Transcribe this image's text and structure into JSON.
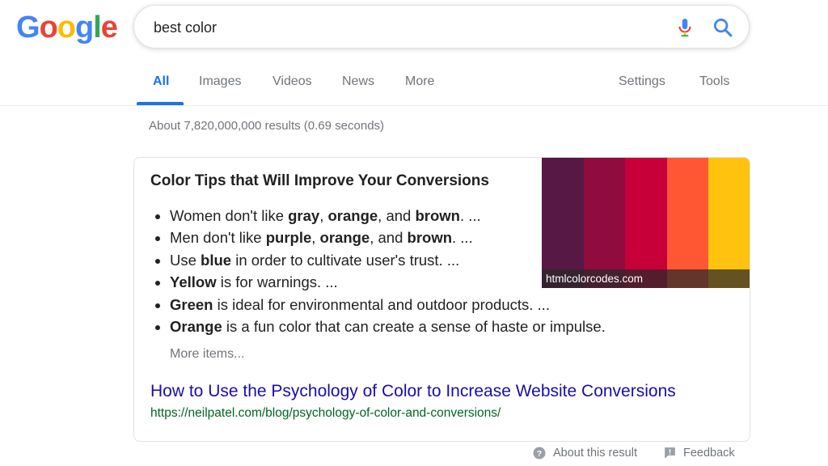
{
  "logo": {
    "text": "Google",
    "letters": [
      "G",
      "o",
      "o",
      "g",
      "l",
      "e"
    ]
  },
  "search": {
    "query": "best color",
    "placeholder": ""
  },
  "icons": {
    "mic": "microphone-icon",
    "search": "search-icon",
    "help": "help-circle-icon",
    "feedback": "feedback-icon"
  },
  "tabs": {
    "all": "All",
    "images": "Images",
    "videos": "Videos",
    "news": "News",
    "more": "More",
    "settings": "Settings",
    "tools": "Tools"
  },
  "stats": "About 7,820,000,000 results (0.69 seconds)",
  "snippet": {
    "title": "Color Tips that Will Improve Your Conversions",
    "items": [
      [
        {
          "t": "Women don't like ",
          "b": false
        },
        {
          "t": "gray",
          "b": true
        },
        {
          "t": ", ",
          "b": false
        },
        {
          "t": "orange",
          "b": true
        },
        {
          "t": ", and ",
          "b": false
        },
        {
          "t": "brown",
          "b": true
        },
        {
          "t": ". ...",
          "b": false
        }
      ],
      [
        {
          "t": "Men don't like ",
          "b": false
        },
        {
          "t": "purple",
          "b": true
        },
        {
          "t": ", ",
          "b": false
        },
        {
          "t": "orange",
          "b": true
        },
        {
          "t": ", and ",
          "b": false
        },
        {
          "t": "brown",
          "b": true
        },
        {
          "t": ". ...",
          "b": false
        }
      ],
      [
        {
          "t": "Use ",
          "b": false
        },
        {
          "t": "blue",
          "b": true
        },
        {
          "t": " in order to cultivate user's trust. ...",
          "b": false
        }
      ],
      [
        {
          "t": "Yellow",
          "b": true
        },
        {
          "t": " is for warnings. ...",
          "b": false
        }
      ],
      [
        {
          "t": "Green",
          "b": true
        },
        {
          "t": " is ideal for environmental and outdoor products. ...",
          "b": false
        }
      ],
      [
        {
          "t": "Orange",
          "b": true
        },
        {
          "t": " is a fun color that can create a sense of haste or impulse.",
          "b": false
        }
      ]
    ],
    "more_items": "More items...",
    "result_title": "How to Use the Psychology of Color to Increase Website Conversions",
    "result_url": "https://neilpatel.com/blog/psychology-of-color-and-conversions/",
    "image_caption": "htmlcolorcodes.com",
    "swatch_colors": [
      "#581845",
      "#900C3F",
      "#C70039",
      "#FF5733",
      "#FFC30F"
    ]
  },
  "footer": {
    "about": "About this result",
    "feedback": "Feedback"
  },
  "colors": {
    "accent": "#1a73e8",
    "link": "#1a0dab",
    "url": "#006621",
    "logo": [
      "#4285F4",
      "#EA4335",
      "#FBBC05",
      "#4285F4",
      "#34A853",
      "#EA4335"
    ]
  }
}
